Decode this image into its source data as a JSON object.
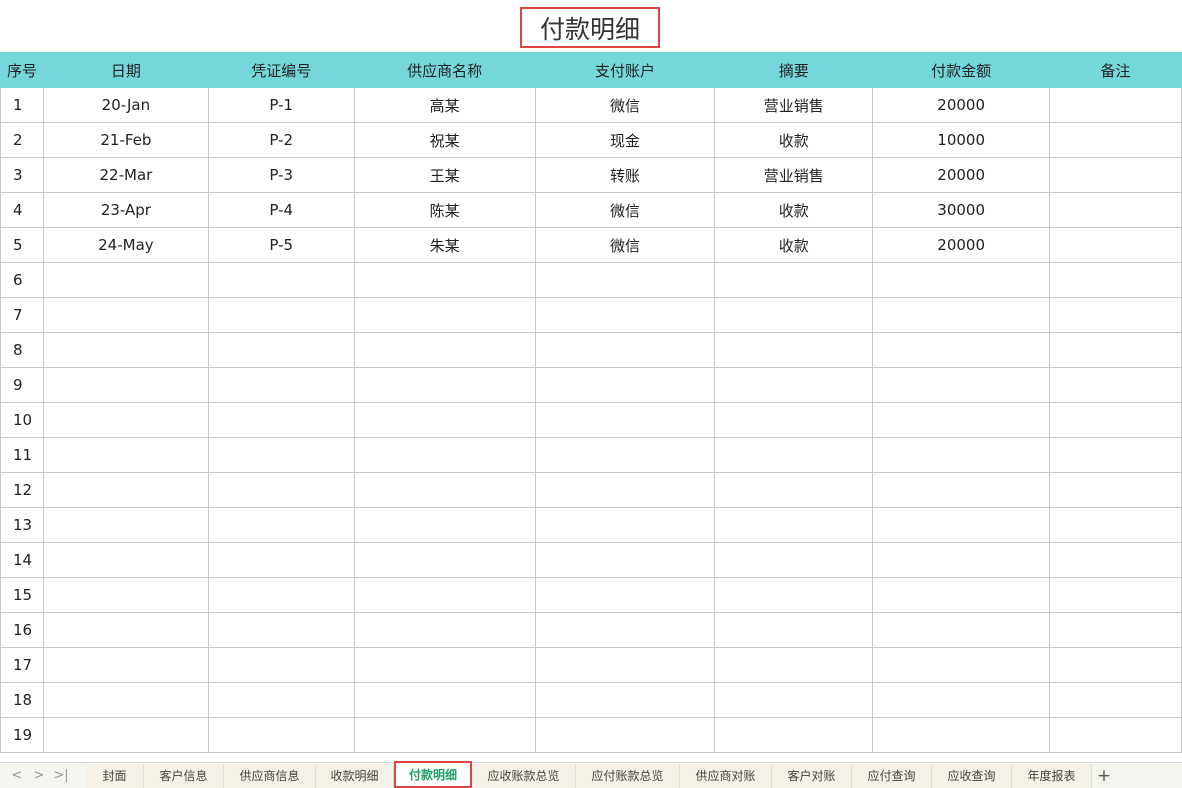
{
  "sheet_title": "付款明细",
  "columns": [
    "序号",
    "日期",
    "凭证编号",
    "供应商名称",
    "支付账户",
    "摘要",
    "付款金额",
    "备注"
  ],
  "rows": [
    [
      "1",
      "20-Jan",
      "P-1",
      "高某",
      "微信",
      "营业销售",
      "20000",
      ""
    ],
    [
      "2",
      "21-Feb",
      "P-2",
      "祝某",
      "现金",
      "收款",
      "10000",
      ""
    ],
    [
      "3",
      "22-Mar",
      "P-3",
      "王某",
      "转账",
      "营业销售",
      "20000",
      ""
    ],
    [
      "4",
      "23-Apr",
      "P-4",
      "陈某",
      "微信",
      "收款",
      "30000",
      ""
    ],
    [
      "5",
      "24-May",
      "P-5",
      "朱某",
      "微信",
      "收款",
      "20000",
      ""
    ],
    [
      "6",
      "",
      "",
      "",
      "",
      "",
      "",
      ""
    ],
    [
      "7",
      "",
      "",
      "",
      "",
      "",
      "",
      ""
    ],
    [
      "8",
      "",
      "",
      "",
      "",
      "",
      "",
      ""
    ],
    [
      "9",
      "",
      "",
      "",
      "",
      "",
      "",
      ""
    ],
    [
      "10",
      "",
      "",
      "",
      "",
      "",
      "",
      ""
    ],
    [
      "11",
      "",
      "",
      "",
      "",
      "",
      "",
      ""
    ],
    [
      "12",
      "",
      "",
      "",
      "",
      "",
      "",
      ""
    ],
    [
      "13",
      "",
      "",
      "",
      "",
      "",
      "",
      ""
    ],
    [
      "14",
      "",
      "",
      "",
      "",
      "",
      "",
      ""
    ],
    [
      "15",
      "",
      "",
      "",
      "",
      "",
      "",
      ""
    ],
    [
      "16",
      "",
      "",
      "",
      "",
      "",
      "",
      ""
    ],
    [
      "17",
      "",
      "",
      "",
      "",
      "",
      "",
      ""
    ],
    [
      "18",
      "",
      "",
      "",
      "",
      "",
      "",
      ""
    ],
    [
      "19",
      "",
      "",
      "",
      "",
      "",
      "",
      ""
    ]
  ],
  "tab_nav": {
    "prev": "<",
    "next": ">",
    "last": ">|"
  },
  "tabs": [
    "封面",
    "客户信息",
    "供应商信息",
    "收款明细",
    "付款明细",
    "应收账款总览",
    "应付账款总览",
    "供应商对账",
    "客户对账",
    "应付查询",
    "应收查询",
    "年度报表"
  ],
  "active_tab": 4,
  "add_tab": "+",
  "colors": {
    "header_bg": "#76d7db",
    "active_tab_text": "#20a162",
    "highlight_border": "#e04444"
  }
}
